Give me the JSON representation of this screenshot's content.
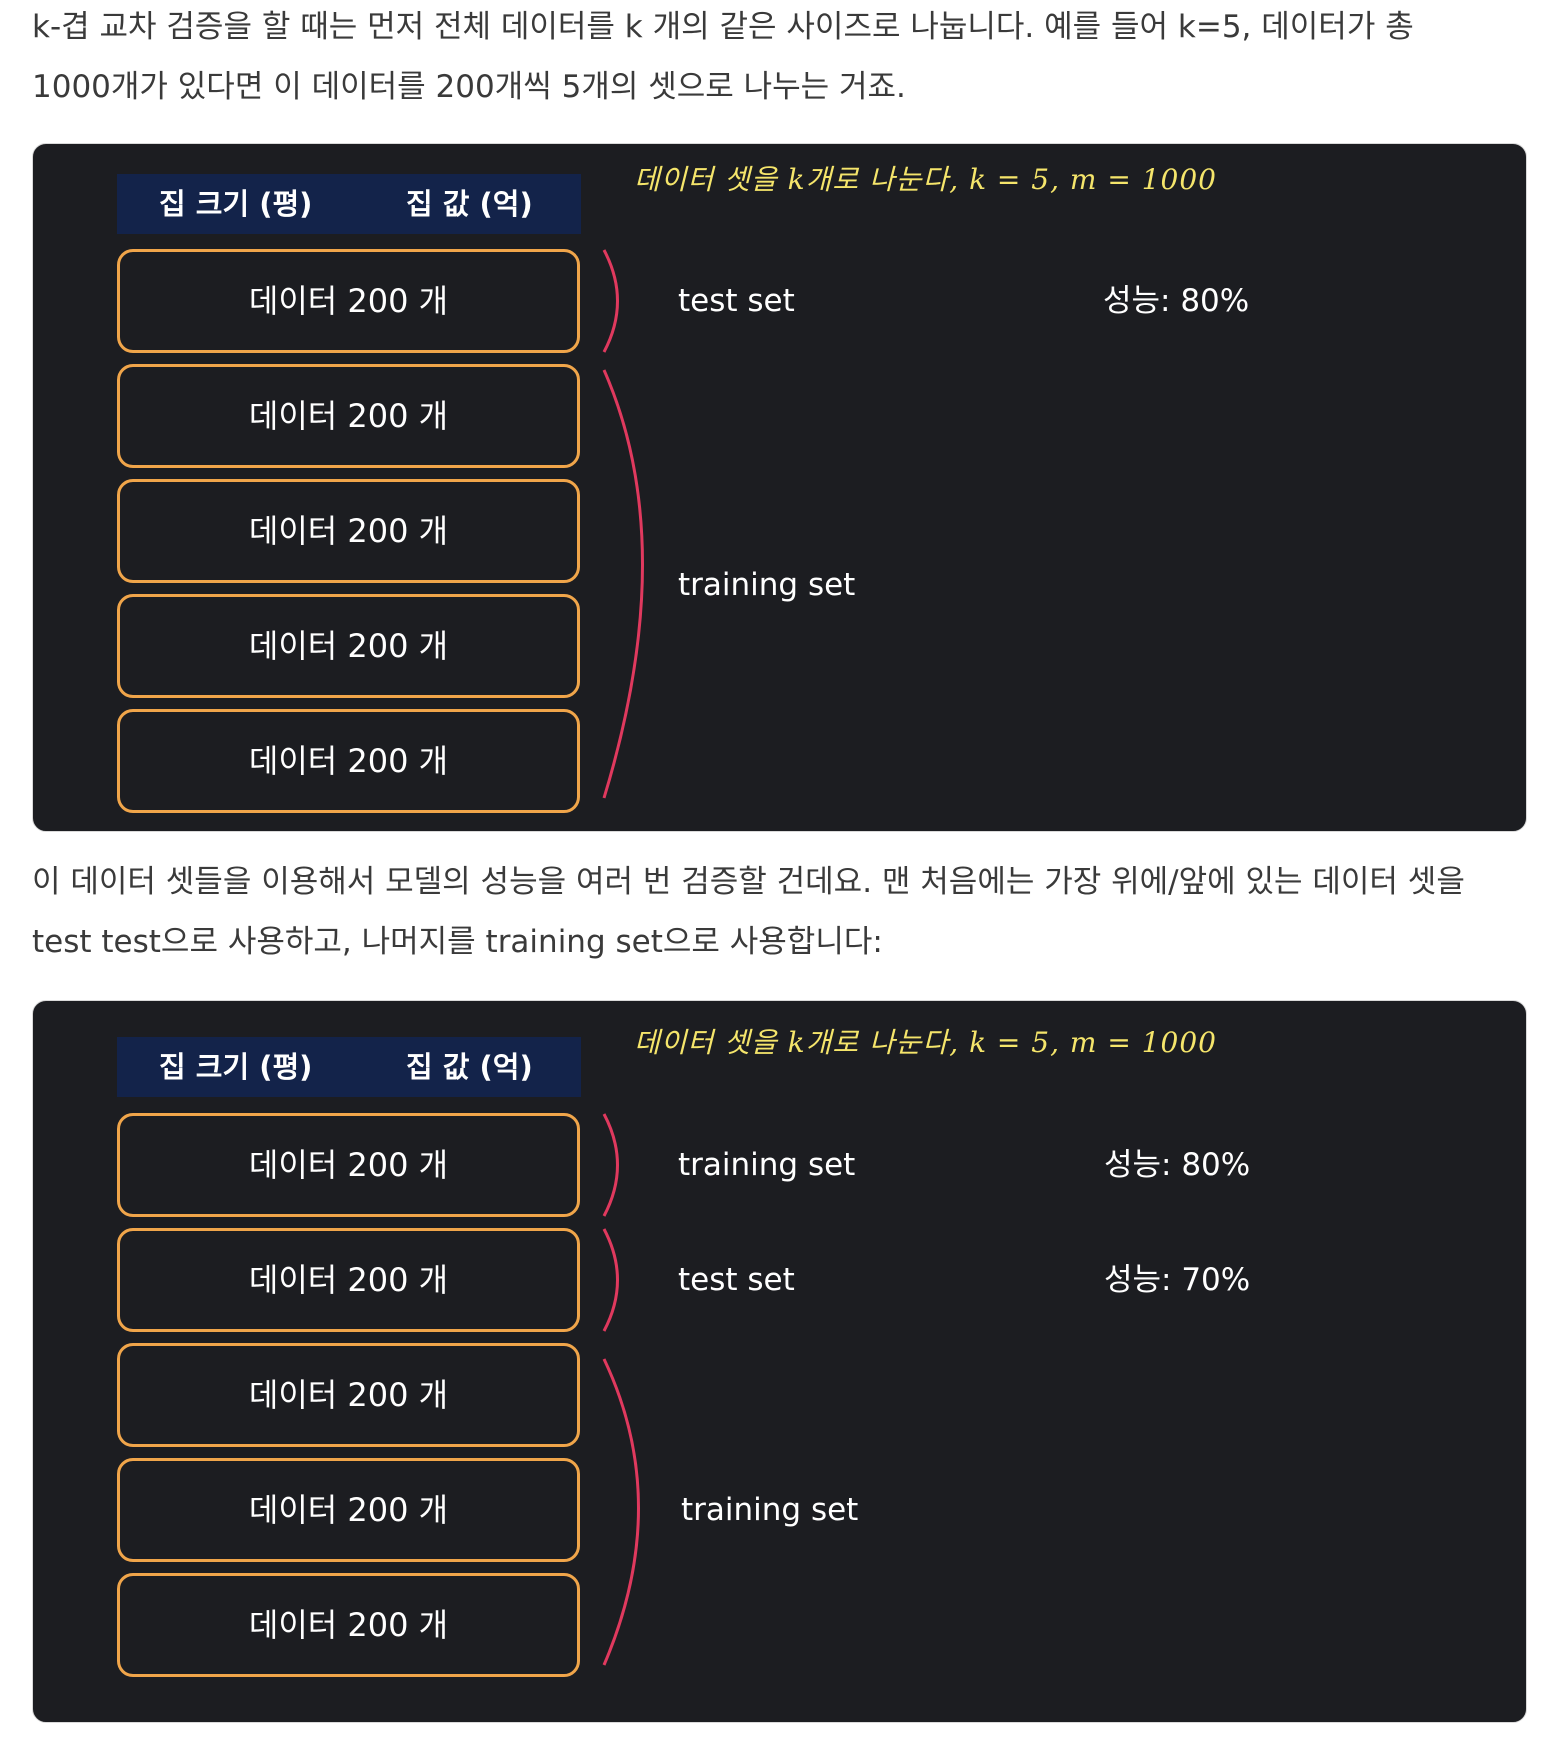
{
  "paragraphs": {
    "intro_line1": "k-겹 교차 검증을 할 때는 먼저 전체 데이터를 k 개의 같은 사이즈로 나눕니다. 예를 들어 k=5, 데이터가 총",
    "intro_line2": "1000개가 있다면 이 데이터를 200개씩 5개의 셋으로 나누는 거죠.",
    "second_line1": "이 데이터 셋들을 이용해서 모델의 성능을 여러 번 검증할 건데요. 맨 처음에는 가장 위에/앞에 있는 데이터 셋을",
    "second_line2": "test test으로 사용하고, 나머지를 training set으로 사용합니다:"
  },
  "diagram1": {
    "header_col1": "집 크기 (평)",
    "header_col2": "집 값 (억)",
    "note": "데이터 셋을 k개로 나눈다, k = 5, m = 1000",
    "boxes": [
      "데이터 200 개",
      "데이터 200 개",
      "데이터 200 개",
      "데이터 200 개",
      "데이터 200 개"
    ],
    "set_label_1": "test set",
    "perf_1": "성능: 80%",
    "set_label_2": "training set",
    "bracket_color": "#e0395e",
    "box_border_color": "#f0a54a"
  },
  "diagram2": {
    "header_col1": "집 크기 (평)",
    "header_col2": "집 값 (억)",
    "note": "데이터 셋을 k개로 나눈다, k = 5, m = 1000",
    "boxes": [
      "데이터 200 개",
      "데이터 200 개",
      "데이터 200 개",
      "데이터 200 개",
      "데이터 200 개"
    ],
    "set_label_1": "training set",
    "perf_1": "성능: 80%",
    "set_label_2": "test set",
    "perf_2": "성능: 70%",
    "set_label_3": "training set",
    "bracket_color": "#e0395e",
    "box_border_color": "#f0a54a"
  }
}
